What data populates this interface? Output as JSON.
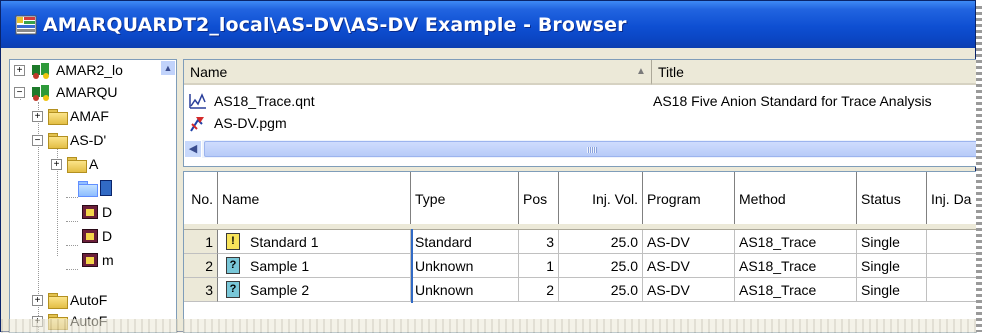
{
  "window": {
    "title": "AMARQUARDT2_local\\AS-DV\\AS-DV Example - Browser"
  },
  "tree": {
    "items": [
      {
        "label": "AMAR2_lo",
        "kind": "server",
        "expander": "+"
      },
      {
        "label": "AMARQU",
        "kind": "server",
        "expander": "−"
      },
      {
        "label": "AMAF",
        "kind": "folder",
        "expander": "+"
      },
      {
        "label": "AS-D'",
        "kind": "folder",
        "expander": "−"
      },
      {
        "label": "A",
        "kind": "folder",
        "expander": "+"
      },
      {
        "label": "",
        "kind": "sequence-selected",
        "expander": ""
      },
      {
        "label": "D",
        "kind": "sequence",
        "expander": ""
      },
      {
        "label": "D",
        "kind": "sequence",
        "expander": ""
      },
      {
        "label": "m",
        "kind": "sequence",
        "expander": ""
      },
      {
        "label": "AutoF",
        "kind": "folder",
        "expander": "+"
      },
      {
        "label": "AutoF",
        "kind": "folder",
        "expander": "+"
      }
    ],
    "scroll_up_glyph": "▲"
  },
  "files": {
    "columns": {
      "name": "Name",
      "sort_glyph": "▲",
      "title": "Title"
    },
    "rows": [
      {
        "name": "AS18_Trace.qnt",
        "title": "AS18 Five Anion Standard for Trace Analysis",
        "icon": "quantification-icon"
      },
      {
        "name": "AS-DV.pgm",
        "title": "",
        "icon": "program-icon"
      }
    ],
    "scroll_left_glyph": "◀"
  },
  "sequence": {
    "columns": [
      "No.",
      "Name",
      "Type",
      "Pos",
      "Inj. Vol.",
      "Program",
      "Method",
      "Status",
      "Inj. Da"
    ],
    "rows": [
      {
        "no": "1",
        "icon_glyph": "!",
        "icon": "standard-sample-icon",
        "name": "Standard 1",
        "type": "Standard",
        "pos": "3",
        "inj_vol": "25.0",
        "program": "AS-DV",
        "method": "AS18_Trace",
        "status": "Single"
      },
      {
        "no": "2",
        "icon_glyph": "?",
        "icon": "unknown-sample-icon",
        "name": "Sample 1",
        "type": "Unknown",
        "pos": "1",
        "inj_vol": "25.0",
        "program": "AS-DV",
        "method": "AS18_Trace",
        "status": "Single"
      },
      {
        "no": "3",
        "icon_glyph": "?",
        "icon": "unknown-sample-icon",
        "name": "Sample 2",
        "type": "Unknown",
        "pos": "2",
        "inj_vol": "25.0",
        "program": "AS-DV",
        "method": "AS18_Trace",
        "status": "Single"
      }
    ]
  },
  "colors": {
    "titlebar": "#0e4fd2",
    "selection": "#316ac5",
    "standard_icon": "#f8e45a",
    "unknown_icon": "#79c7d8"
  }
}
